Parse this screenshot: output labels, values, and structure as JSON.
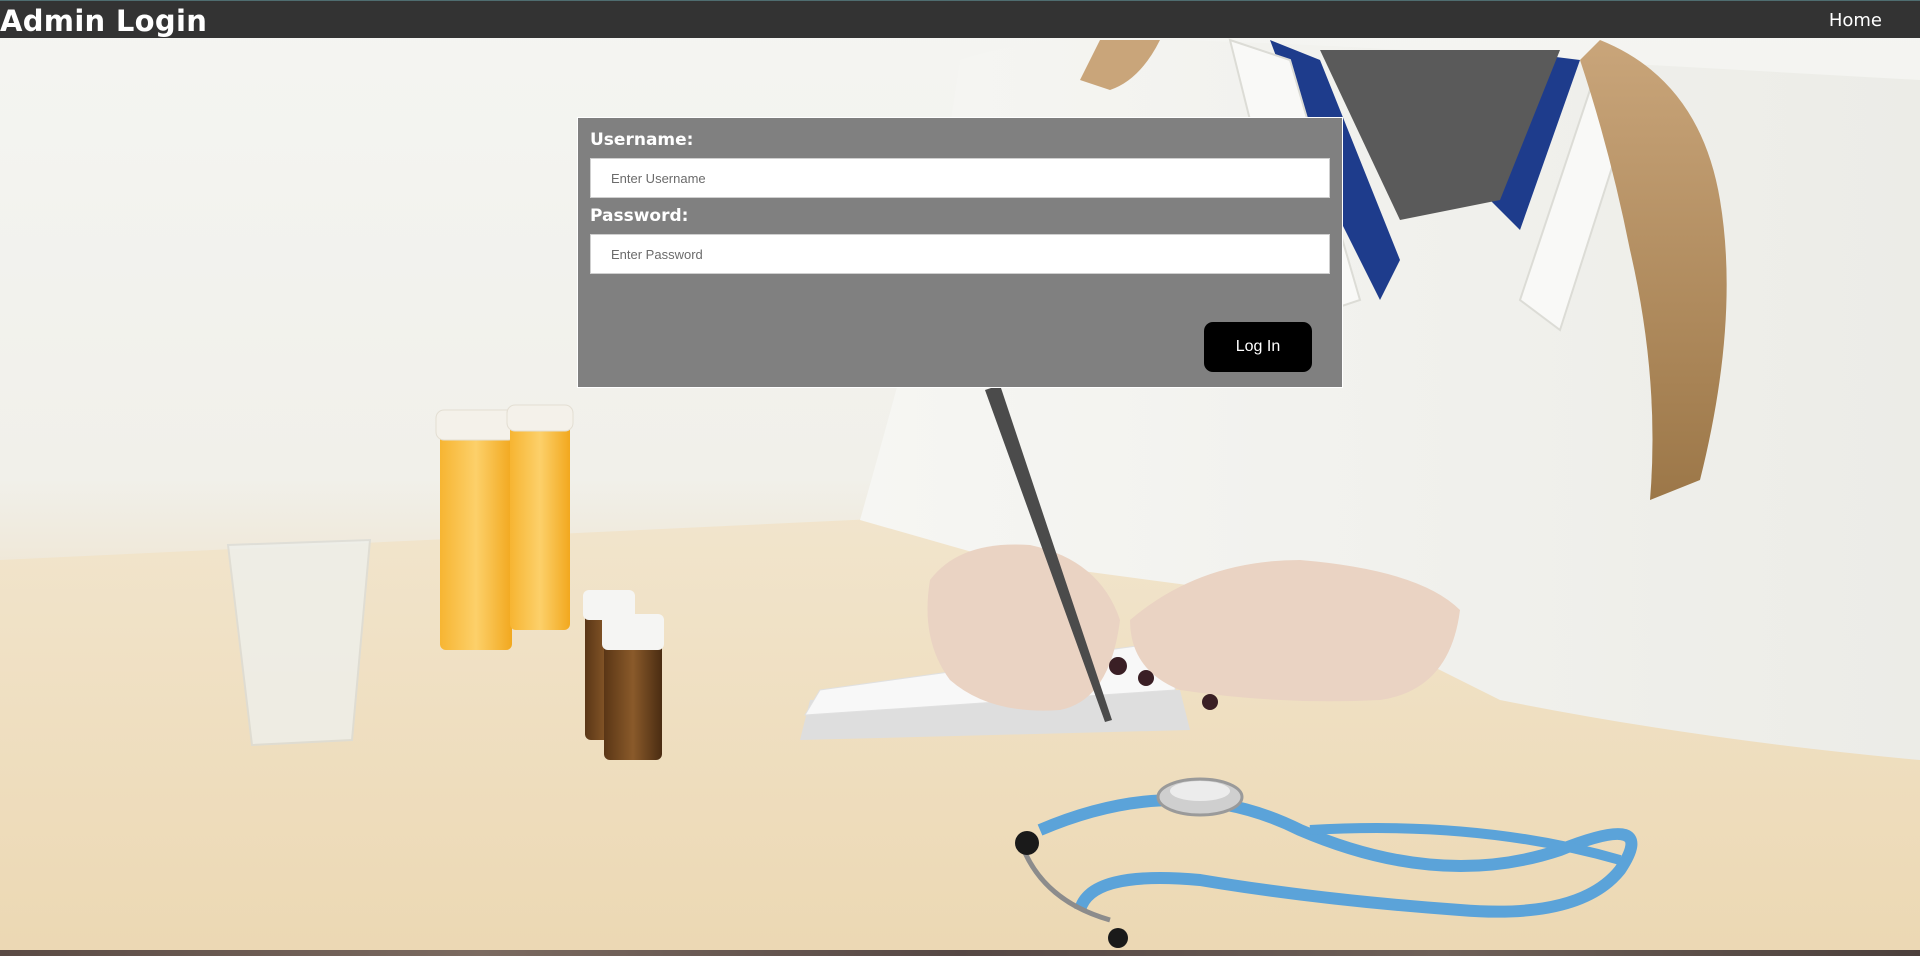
{
  "header": {
    "title": "Admin Login",
    "home_link": "Home"
  },
  "login_form": {
    "username_label": "Username:",
    "username_placeholder": "Enter Username",
    "username_value": "",
    "password_label": "Password:",
    "password_placeholder": "Enter Password",
    "password_value": "",
    "submit_label": "Log In"
  },
  "colors": {
    "header_bg": "#333333",
    "panel_bg": "#808080",
    "button_bg": "#000000",
    "stethoscope": "#5ba3d9"
  }
}
